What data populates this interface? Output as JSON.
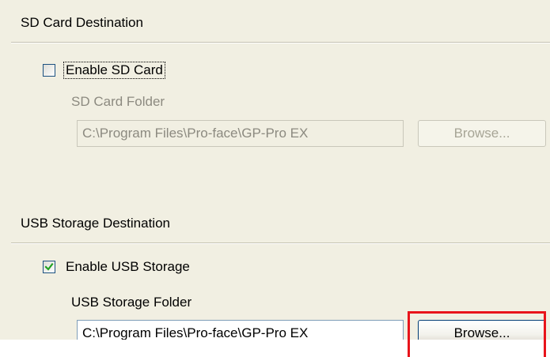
{
  "sd_section": {
    "title": "SD Card Destination",
    "enable_label": "Enable SD Card",
    "enabled": false,
    "folder_label": "SD Card Folder",
    "folder_value": "C:\\Program Files\\Pro-face\\GP-Pro EX",
    "browse_label": "Browse..."
  },
  "usb_section": {
    "title": "USB Storage Destination",
    "enable_label": "Enable USB Storage",
    "enabled": true,
    "folder_label": "USB Storage Folder",
    "folder_value": "C:\\Program Files\\Pro-face\\GP-Pro EX",
    "browse_label": "Browse..."
  },
  "colors": {
    "highlight": "#e8141b",
    "checkmark": "#21a121",
    "disabled_text": "#8c8a80",
    "panel_background": "#f1efe2"
  }
}
